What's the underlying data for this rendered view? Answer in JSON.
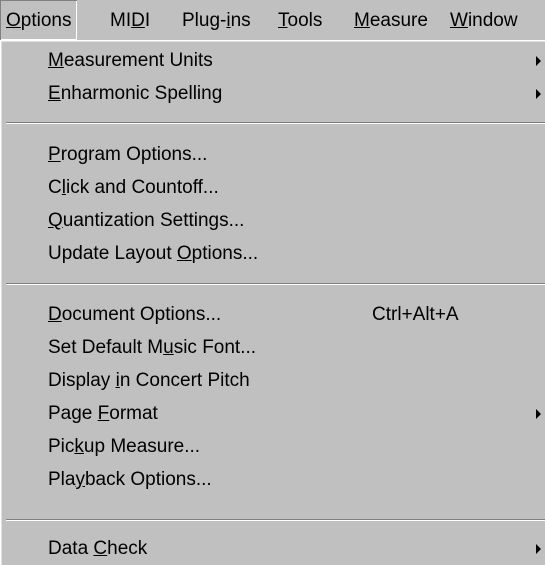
{
  "menubar": {
    "items": [
      {
        "pre": "",
        "key": "O",
        "post": "ptions"
      },
      {
        "pre": "MI",
        "key": "D",
        "post": "I"
      },
      {
        "pre": "Plug-",
        "key": "i",
        "post": "ns"
      },
      {
        "pre": "",
        "key": "T",
        "post": "ools"
      },
      {
        "pre": "",
        "key": "M",
        "post": "easure"
      },
      {
        "pre": "",
        "key": "W",
        "post": "indow"
      }
    ]
  },
  "menu": {
    "items": [
      {
        "pre": "",
        "key": "M",
        "post": "easurement Units"
      },
      {
        "pre": "",
        "key": "E",
        "post": "nharmonic Spelling"
      },
      {
        "pre": "",
        "key": "P",
        "post": "rogram Options..."
      },
      {
        "pre": "C",
        "key": "l",
        "post": "ick and Countoff..."
      },
      {
        "pre": "",
        "key": "Q",
        "post": "uantization Settings..."
      },
      {
        "pre": "Update Layout ",
        "key": "O",
        "post": "ptions..."
      },
      {
        "pre": "",
        "key": "D",
        "post": "ocument Options...",
        "shortcut": "Ctrl+Alt+A"
      },
      {
        "pre": "Set Default M",
        "key": "u",
        "post": "sic Font..."
      },
      {
        "pre": "Display ",
        "key": "i",
        "post": "n Concert Pitch"
      },
      {
        "pre": "Page ",
        "key": "F",
        "post": "ormat"
      },
      {
        "pre": "Pic",
        "key": "k",
        "post": "up Measure..."
      },
      {
        "pre": "Pla",
        "key": "y",
        "post": "back Options..."
      },
      {
        "pre": "Data ",
        "key": "C",
        "post": "heck"
      }
    ]
  },
  "icons": {
    "submenu_arrow": "submenu-arrow-icon"
  },
  "colors": {
    "face": "#c0c0c0",
    "shadow": "#808080",
    "highlight": "#ffffff",
    "text": "#000000"
  }
}
